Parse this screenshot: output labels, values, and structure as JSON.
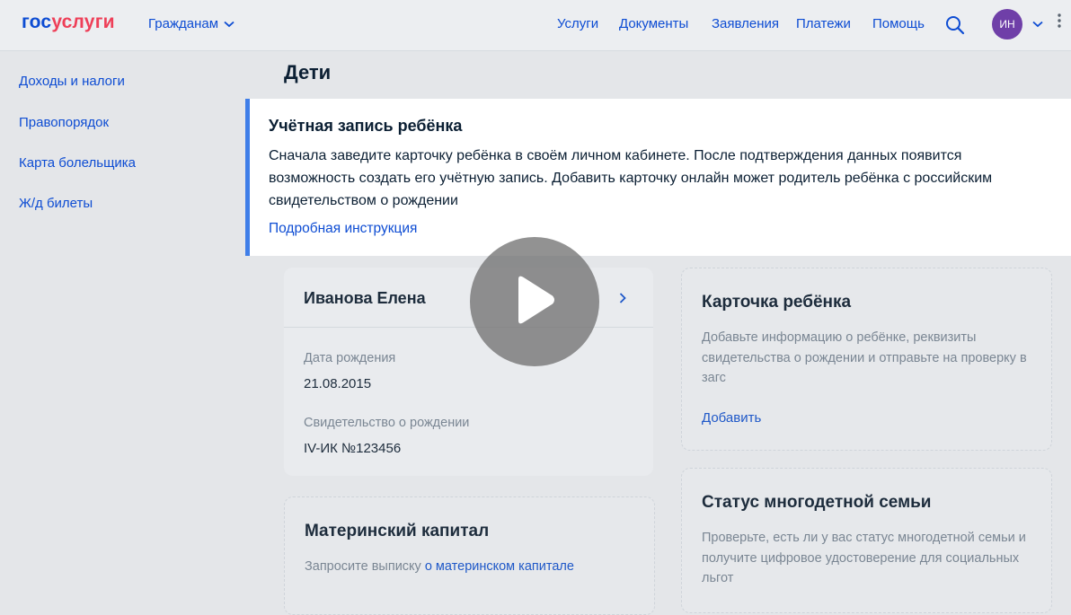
{
  "header": {
    "logo_part1": "гос",
    "logo_part2": "услуги",
    "audience": "Гражданам",
    "nav": [
      "Услуги",
      "Документы",
      "Заявления",
      "Платежи",
      "Помощь"
    ],
    "avatar_initials": "ИН"
  },
  "sidebar": {
    "items": [
      "Доходы и налоги",
      "Правопорядок",
      "Карта болельщика",
      "Ж/д билеты"
    ]
  },
  "page": {
    "title": "Дети"
  },
  "alert": {
    "title": "Учётная запись ребёнка",
    "text": "Сначала заведите карточку ребёнка в своём личном кабинете. После подтверждения данных появится возможность создать его учётную запись. Добавить карточку онлайн может родитель ребёнка с российским свидетельством о рождении",
    "link": "Подробная инструкция"
  },
  "child_card": {
    "name": "Иванова Елена",
    "birth_label": "Дата рождения",
    "birth_value": "21.08.2015",
    "cert_label": "Свидетельство о рождении",
    "cert_value": "IV-ИК №123456"
  },
  "add_card": {
    "title": "Карточка ребёнка",
    "text": "Добавьте информацию о ребёнке, реквизиты свидетельства о рождении и отправьте на проверку в загс",
    "link": "Добавить"
  },
  "capital_card": {
    "title": "Материнский капитал",
    "text_prefix": "Запросите выписку ",
    "text_link": "о материнском капитале"
  },
  "large_family_card": {
    "title": "Статус многодетной семьи",
    "text": "Проверьте, есть ли у вас статус многодетной семьи и получите цифровое удостоверение для социальных льгот"
  },
  "colors": {
    "brand_blue": "#0d4cd3",
    "brand_red": "#ee3f58",
    "alert_accent": "#3f7ee8",
    "avatar": "#6f3fa8"
  }
}
